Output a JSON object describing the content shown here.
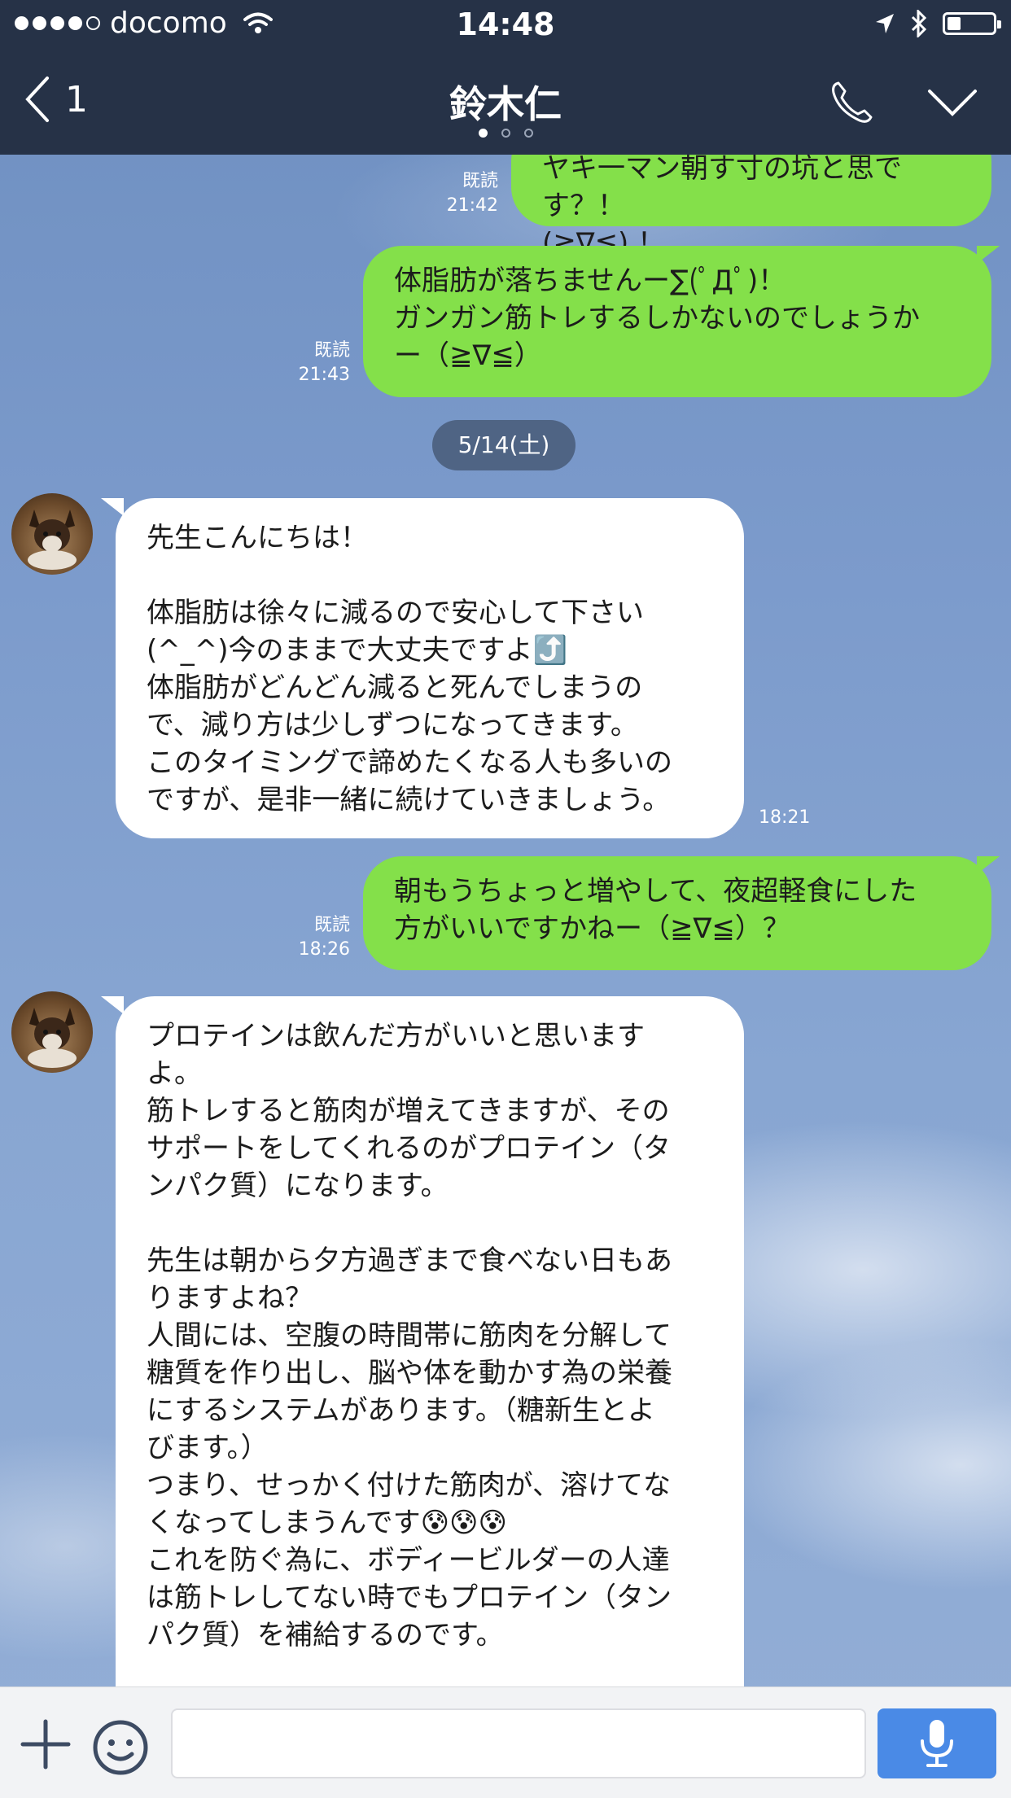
{
  "status_bar": {
    "carrier": "docomo",
    "time": "14:48",
    "battery_level": 0.3
  },
  "nav": {
    "back_count": "1",
    "title": "鈴木仁"
  },
  "chat": {
    "messages": [
      {
        "from": "me",
        "text": "ヤキ一マン朝す寸の坑と思です？！\n(≧∇≦) ！",
        "read": "既読",
        "time": "21:42"
      },
      {
        "from": "me",
        "text": "体脂肪が落ちませんー∑(ﾟДﾟ)！\nガンガン筋トレするしかないのでしょうか\nー（≧∇≦）",
        "read": "既読",
        "time": "21:43"
      },
      {
        "from": "them",
        "text": "先生こんにちは！\n\n体脂肪は徐々に減るので安心して下さい\n(^_^)今のままで大丈夫ですよ⤴️\n体脂肪がどんどん減ると死んでしまうの\nで、減り方は少しずつになってきます。\nこのタイミングで諦めたくなる人も多いの\nですが、是非一緒に続けていきましょう。",
        "time": "18:21"
      },
      {
        "from": "me",
        "text": "朝もうちょっと増やして、夜超軽食にした\n方がいいですかねー（≧∇≦）？",
        "read": "既読",
        "time": "18:26"
      },
      {
        "from": "them",
        "text": "プロテインは飲んだ方がいいと思います\nよ。\n筋トレすると筋肉が増えてきますが、その\nサポートをしてくれるのがプロテイン（タ\nンパク質）になります。\n\n先生は朝から夕方過ぎまで食べない日もあ\nりますよね？\n人間には、空腹の時間帯に筋肉を分解して\n糖質を作り出し、脳や体を動かす為の栄養\nにするシステムがあります。（糖新生とよ\nびます。）\nつまり、せっかく付けた筋肉が、溶けてな\nくなってしまうんです😰😰😰\nこれを防ぐ為に、ボディービルダーの人達\nは筋トレしてない時でもプロテイン（タン\nパク質）を補給するのです。"
      }
    ],
    "date_divider": "5/14(土)"
  },
  "input": {
    "value": ""
  }
}
